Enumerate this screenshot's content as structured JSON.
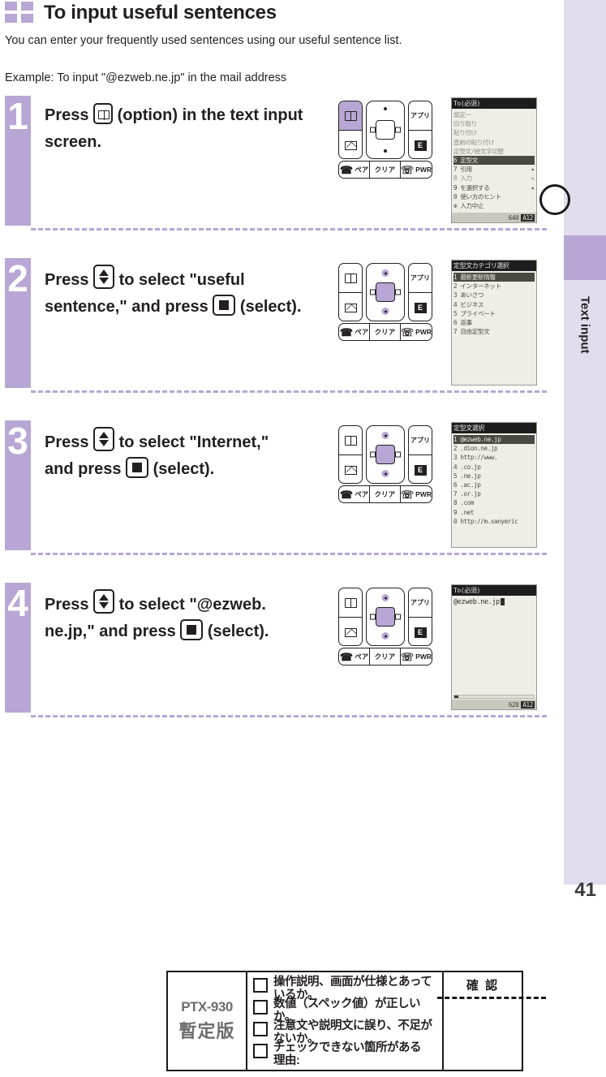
{
  "header": {
    "title": "To input useful sentences",
    "icon": "grid-squares-icon",
    "accent_color": "#b8a6d4"
  },
  "intro": "You can enter your frequently used sentences using our useful sentence list.",
  "example": "Example: To input \"@ezweb.ne.jp\" in the mail address",
  "side_tab": {
    "label": "Text input"
  },
  "page_number": "41",
  "steps": [
    {
      "number": "1",
      "line1_pre": "Press",
      "key1": "book-option-key",
      "line1_post": "(option) in the text input",
      "line2": "screen.",
      "keypad": {
        "left_top_highlight": true,
        "center_highlight": false,
        "updown_highlight": false
      },
      "screen": {
        "title": "To(必須)",
        "type": "menu",
        "rows": [
          {
            "text": "留定ー",
            "faint": true,
            "selected": false,
            "arrow": ""
          },
          {
            "text": "切り取り",
            "faint": true,
            "selected": false,
            "arrow": ""
          },
          {
            "text": "貼り付け",
            "faint": true,
            "selected": false,
            "arrow": ""
          },
          {
            "text": "直前の貼り付け",
            "faint": true,
            "selected": false,
            "arrow": ""
          },
          {
            "text": "定型文/絵文字切替",
            "faint": true,
            "selected": false,
            "arrow": ""
          },
          {
            "text": "6 定型文",
            "faint": false,
            "selected": true,
            "arrow": ""
          },
          {
            "text": "7 引用",
            "faint": false,
            "selected": false,
            "arrow": "▸"
          },
          {
            "text": "8 入力",
            "faint": true,
            "selected": false,
            "arrow": "▸"
          },
          {
            "text": "9 を選択する",
            "faint": false,
            "selected": false,
            "arrow": "▸"
          },
          {
            "text": "0 使い方のヒント",
            "faint": false,
            "selected": false,
            "arrow": ""
          },
          {
            "text": "✻ 入力中止",
            "faint": false,
            "selected": false,
            "arrow": ""
          }
        ],
        "footer": {
          "count": "640",
          "badge": "A12"
        }
      }
    },
    {
      "number": "2",
      "line1_pre": "Press",
      "key1": "up-down-key",
      "line1_post": "to select \"useful",
      "line2_pre": "sentence,\" and press",
      "key2": "center-select-key",
      "line2_post": "(select).",
      "keypad": {
        "left_top_highlight": false,
        "center_highlight": true,
        "updown_highlight": true
      },
      "screen": {
        "title": "定型文カテゴリ選択",
        "type": "menu",
        "rows": [
          {
            "text": "1 最新更新情報",
            "faint": false,
            "selected": true,
            "arrow": ""
          },
          {
            "text": "2 インターネット",
            "faint": false,
            "selected": false,
            "arrow": ""
          },
          {
            "text": "3 あいさつ",
            "faint": false,
            "selected": false,
            "arrow": ""
          },
          {
            "text": "4 ビジネス",
            "faint": false,
            "selected": false,
            "arrow": ""
          },
          {
            "text": "5 プライベート",
            "faint": false,
            "selected": false,
            "arrow": ""
          },
          {
            "text": "6 返事",
            "faint": false,
            "selected": false,
            "arrow": ""
          },
          {
            "text": "7 自由定型文",
            "faint": false,
            "selected": false,
            "arrow": ""
          }
        ],
        "footer": {
          "count": "",
          "badge": ""
        }
      }
    },
    {
      "number": "3",
      "line1_pre": "Press",
      "key1": "up-down-key",
      "line1_post": "to select \"Internet,\"",
      "line2_pre": "and press",
      "key2": "center-select-key",
      "line2_post": "(select).",
      "keypad": {
        "left_top_highlight": false,
        "center_highlight": true,
        "updown_highlight": true
      },
      "screen": {
        "title": "定型文選択",
        "type": "menu",
        "rows": [
          {
            "text": "1 @ezweb.ne.jp",
            "faint": false,
            "selected": true,
            "arrow": ""
          },
          {
            "text": "2 .dion.ne.jp",
            "faint": false,
            "selected": false,
            "arrow": ""
          },
          {
            "text": "3 http://www.",
            "faint": false,
            "selected": false,
            "arrow": ""
          },
          {
            "text": "4 .co.jp",
            "faint": false,
            "selected": false,
            "arrow": ""
          },
          {
            "text": "5 .ne.jp",
            "faint": false,
            "selected": false,
            "arrow": ""
          },
          {
            "text": "6 .ac.jp",
            "faint": false,
            "selected": false,
            "arrow": ""
          },
          {
            "text": "7 .or.jp",
            "faint": false,
            "selected": false,
            "arrow": ""
          },
          {
            "text": "8 .com",
            "faint": false,
            "selected": false,
            "arrow": ""
          },
          {
            "text": "9 .net",
            "faint": false,
            "selected": false,
            "arrow": ""
          },
          {
            "text": "0 http://m.sanyeric",
            "faint": false,
            "selected": false,
            "arrow": ""
          }
        ],
        "footer": {
          "count": "",
          "badge": ""
        }
      }
    },
    {
      "number": "4",
      "line1_pre": "Press",
      "key1": "up-down-key",
      "line1_post": "to select \"@ezweb.",
      "line2_pre": "ne.jp,\" and press",
      "key2": "center-select-key",
      "line2_post": "(select).",
      "keypad": {
        "left_top_highlight": false,
        "center_highlight": true,
        "updown_highlight": true
      },
      "screen": {
        "title": "To(必須)",
        "type": "text",
        "value": "@ezweb.ne.jp",
        "footer": {
          "count": "628",
          "badge": "A12"
        }
      }
    }
  ],
  "proof_box": {
    "model": "PTX-930",
    "status": "暫定版",
    "items": [
      "操作説明、画面が仕様とあっているか。",
      "数値（スペック値）が正しいか。",
      "注意文や説明文に誤り、不足がないか。",
      "チェックできない箇所がある",
      "理由:"
    ],
    "confirm_label": "確 認"
  }
}
